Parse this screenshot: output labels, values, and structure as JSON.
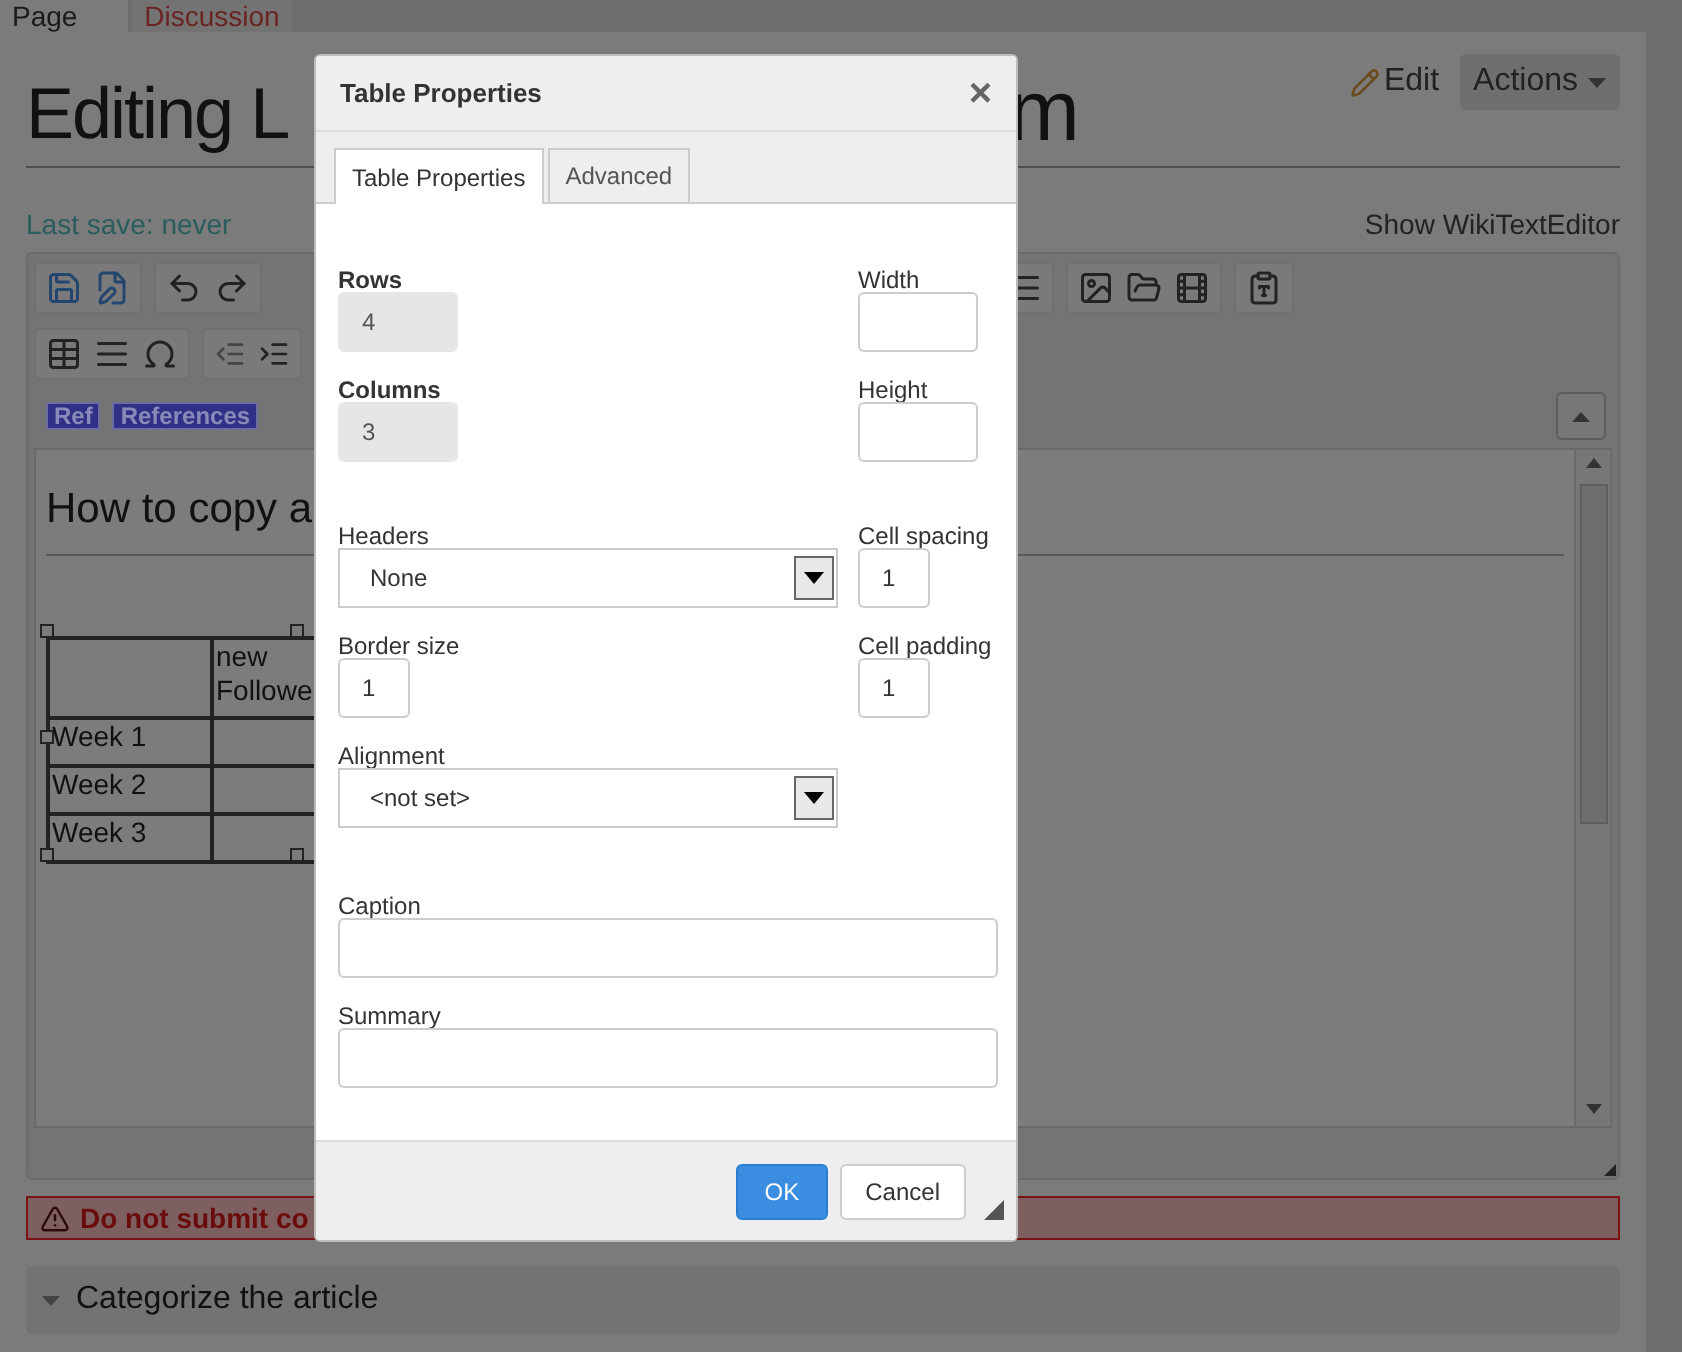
{
  "page_tabs": [
    {
      "label": "Page",
      "selected": true
    },
    {
      "label": "Discussion",
      "selected": false
    }
  ],
  "title_parts": [
    "Editing L",
    "m"
  ],
  "actions": {
    "edit": "Edit",
    "menu": "Actions"
  },
  "last_save": "Last save: never",
  "show_editor": "Show WikiTextEditor",
  "toolbar_tags": [
    "Ref",
    "References"
  ],
  "editor": {
    "heading": "How to copy a",
    "table_rows": [
      [
        "",
        "new Followe"
      ],
      [
        "Week 1",
        ""
      ],
      [
        "Week 2",
        ""
      ],
      [
        "Week 3",
        ""
      ]
    ]
  },
  "warning": "Do not submit co",
  "categorize": "Categorize the article",
  "dialog": {
    "title": "Table Properties",
    "close": "×",
    "tabs": [
      {
        "label": "Table Properties",
        "selected": true
      },
      {
        "label": "Advanced",
        "selected": false
      }
    ],
    "left_fields": [
      {
        "label": "Rows",
        "kind": "text",
        "value": "4",
        "disabled": true
      },
      {
        "label": "Columns",
        "kind": "text",
        "value": "3",
        "disabled": true
      },
      {
        "label": "Headers",
        "kind": "select",
        "value": "None"
      },
      {
        "label": "Border size",
        "kind": "small",
        "value": "1",
        "disabled": false
      },
      {
        "label": "Alignment",
        "kind": "select",
        "value": "<not set>"
      }
    ],
    "right_fields": [
      {
        "label": "Width",
        "kind": "text",
        "disabled": false
      },
      {
        "label": "Height",
        "kind": "text",
        "disabled": false
      },
      {
        "label": "Cell spacing",
        "kind": "small",
        "value": "1",
        "disabled": false
      },
      {
        "label": "Cell padding",
        "kind": "small",
        "value": "1",
        "disabled": false
      }
    ],
    "wide_fields": [
      {
        "label": "Caption"
      },
      {
        "label": "Summary"
      }
    ],
    "buttons": [
      {
        "label": "OK",
        "kind": "primary"
      },
      {
        "label": "Cancel",
        "kind": "default"
      }
    ]
  }
}
